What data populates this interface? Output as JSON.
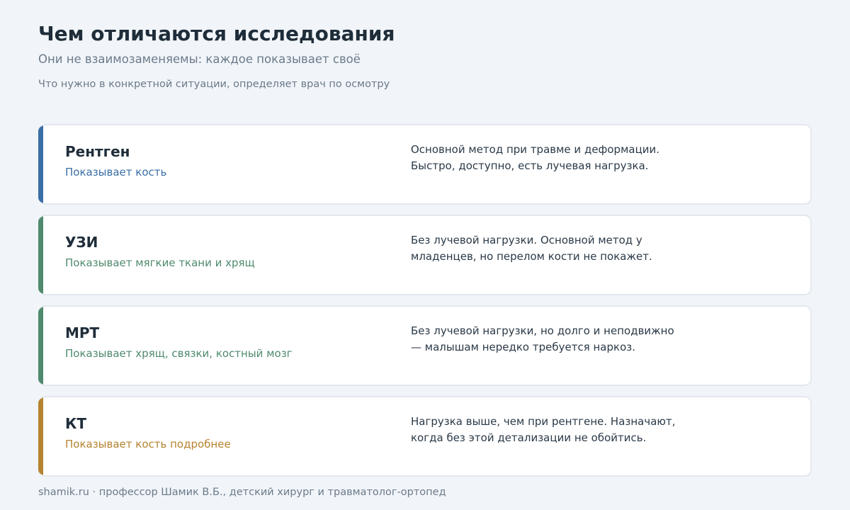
{
  "header": {
    "title": "Чем отличаются исследования",
    "subtitle": "Они не взаимозаменяемы: каждое показывает своё",
    "note": "Что нужно в конкретной ситуации, определяет врач по осмотру"
  },
  "cards": [
    {
      "name": "Рентген",
      "shows": "Показывает кость",
      "description": "Основной метод при травме и деформации.\nБыстро, доступно, есть лучевая нагрузка.",
      "color": "#3a6ea5"
    },
    {
      "name": "УЗИ",
      "shows": "Показывает мягкие ткани и хрящ",
      "description": "Без лучевой нагрузки. Основной метод у\nмладенцев, но перелом кости не покажет.",
      "color": "#4f8a6e"
    },
    {
      "name": "МРТ",
      "shows": "Показывает хрящ, связки, костный мозг",
      "description": "Без лучевой нагрузки, но долго и неподвижно\n— малышам нередко требуется наркоз.",
      "color": "#4f8a6e"
    },
    {
      "name": "КТ",
      "shows": "Показывает кость подробнее",
      "description": "Нагрузка выше, чем при рентгене. Назначают,\nкогда без этой детализации не обойтись.",
      "color": "#b5832f"
    }
  ],
  "footer": {
    "text": "shamik.ru · профессор Шамик В.Б., детский хирург и травматолог-ортопед"
  }
}
